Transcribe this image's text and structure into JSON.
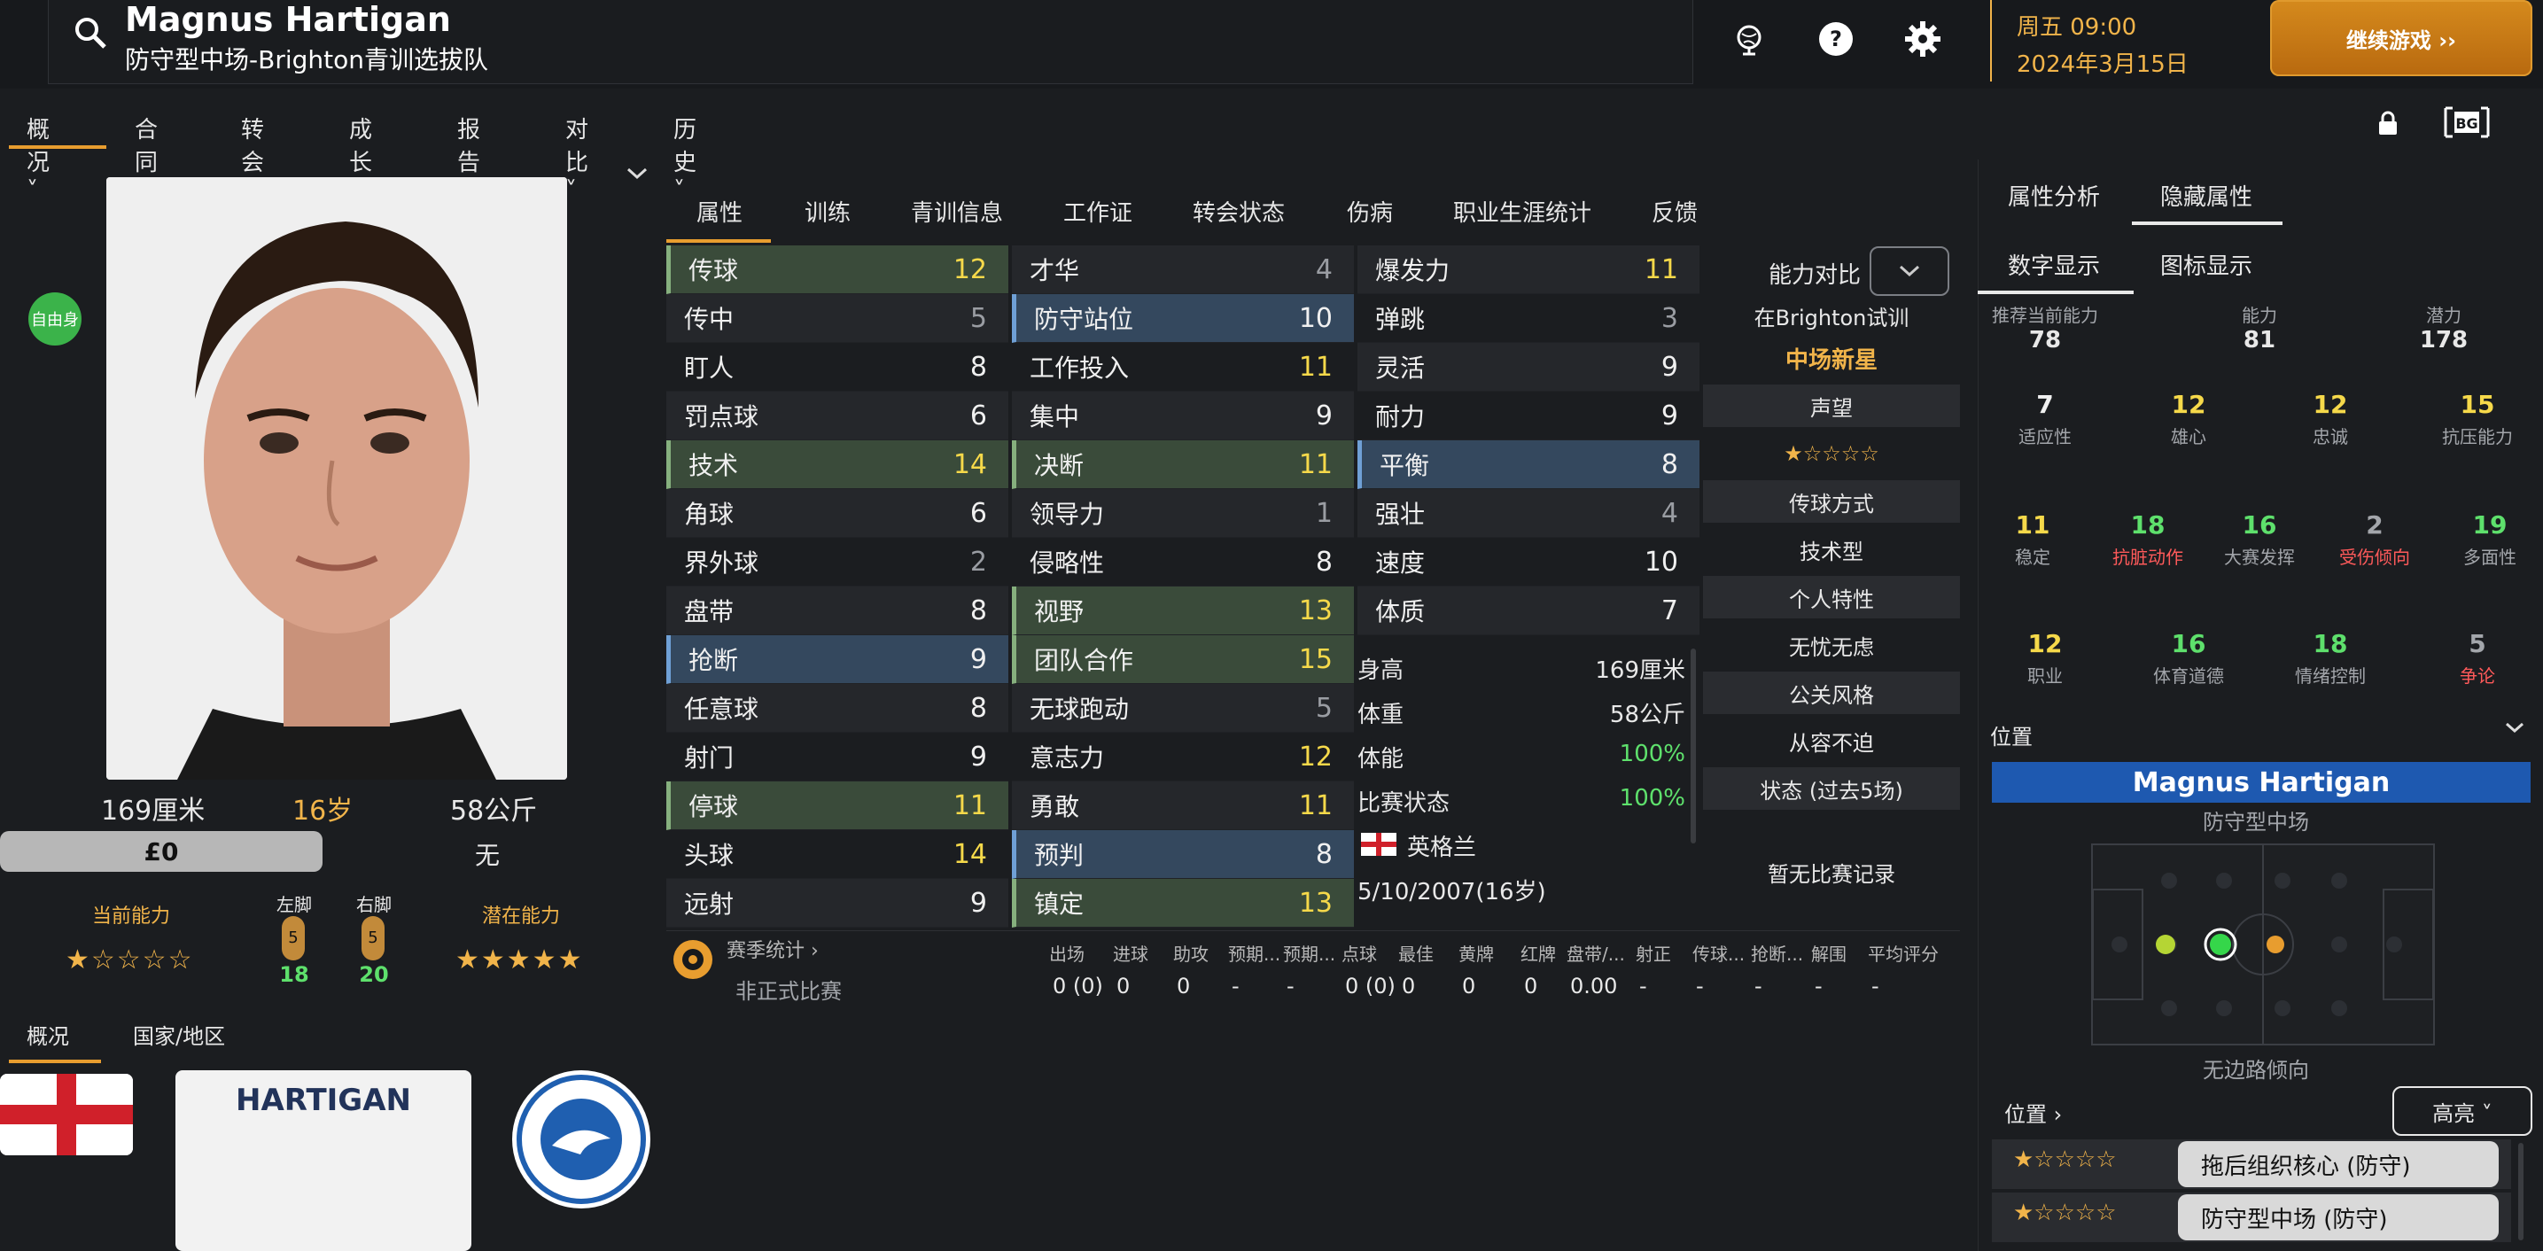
{
  "header": {
    "player_name": "Magnus Hartigan",
    "player_sub": "防守型中场-Brighton青训选拔队",
    "date_line1": "周五 09:00",
    "date_line2": "2024年3月15日",
    "continue_label": "继续游戏 ››"
  },
  "main_nav": [
    "概况 ˅",
    "合同 ˅",
    "转会 ˅",
    "成长 ˅",
    "报告 ˅",
    "对比 ˅",
    "历史 ˅"
  ],
  "left": {
    "free_badge": "自由身",
    "height": "169厘米",
    "age": "16岁",
    "weight": "58公斤",
    "value": "£0",
    "club_status": "无",
    "ca_label": "当前能力",
    "pa_label": "潜在能力",
    "left_foot_label": "左脚",
    "right_foot_label": "右脚",
    "left_foot_value": "18",
    "right_foot_value": "20",
    "foot_badge": "5",
    "ca_stars": "★☆☆☆☆",
    "pa_stars": "★★★★★",
    "tabs": [
      "概况",
      "国家/地区"
    ],
    "shirt_name": "HARTIGAN"
  },
  "attr_tabs": [
    "属性",
    "训练",
    "青训信息",
    "工作证",
    "转会状态",
    "伤病",
    "职业生涯统计",
    "反馈"
  ],
  "attributes": {
    "technical": [
      {
        "name": "传球",
        "value": "12",
        "style": "hl-g",
        "color": "#f6d94a"
      },
      {
        "name": "传中",
        "value": "5",
        "style": "alt",
        "color": "#9a9da3"
      },
      {
        "name": "盯人",
        "value": "8",
        "style": "",
        "color": "#f0f0f0"
      },
      {
        "name": "罚点球",
        "value": "6",
        "style": "alt",
        "color": "#f0f0f0"
      },
      {
        "name": "技术",
        "value": "14",
        "style": "hl-g",
        "color": "#f6d94a"
      },
      {
        "name": "角球",
        "value": "6",
        "style": "alt",
        "color": "#f0f0f0"
      },
      {
        "name": "界外球",
        "value": "2",
        "style": "",
        "color": "#9a9da3"
      },
      {
        "name": "盘带",
        "value": "8",
        "style": "alt",
        "color": "#f0f0f0"
      },
      {
        "name": "抢断",
        "value": "9",
        "style": "hl-b",
        "color": "#f0f0f0"
      },
      {
        "name": "任意球",
        "value": "8",
        "style": "alt",
        "color": "#f0f0f0"
      },
      {
        "name": "射门",
        "value": "9",
        "style": "",
        "color": "#f0f0f0"
      },
      {
        "name": "停球",
        "value": "11",
        "style": "hl-g",
        "color": "#f6d94a"
      },
      {
        "name": "头球",
        "value": "14",
        "style": "",
        "color": "#f6d94a"
      },
      {
        "name": "远射",
        "value": "9",
        "style": "alt",
        "color": "#f0f0f0"
      }
    ],
    "mental": [
      {
        "name": "才华",
        "value": "4",
        "style": "alt",
        "color": "#9a9da3"
      },
      {
        "name": "防守站位",
        "value": "10",
        "style": "hl-b",
        "color": "#f0f0f0"
      },
      {
        "name": "工作投入",
        "value": "11",
        "style": "",
        "color": "#f6d94a"
      },
      {
        "name": "集中",
        "value": "9",
        "style": "alt",
        "color": "#f0f0f0"
      },
      {
        "name": "决断",
        "value": "11",
        "style": "hl-g",
        "color": "#f6d94a"
      },
      {
        "name": "领导力",
        "value": "1",
        "style": "alt",
        "color": "#9a9da3"
      },
      {
        "name": "侵略性",
        "value": "8",
        "style": "",
        "color": "#f0f0f0"
      },
      {
        "name": "视野",
        "value": "13",
        "style": "hl-g",
        "color": "#f6d94a"
      },
      {
        "name": "团队合作",
        "value": "15",
        "style": "hl-g",
        "color": "#f6d94a"
      },
      {
        "name": "无球跑动",
        "value": "5",
        "style": "alt",
        "color": "#9a9da3"
      },
      {
        "name": "意志力",
        "value": "12",
        "style": "",
        "color": "#f6d94a"
      },
      {
        "name": "勇敢",
        "value": "11",
        "style": "alt",
        "color": "#f6d94a"
      },
      {
        "name": "预判",
        "value": "8",
        "style": "hl-b",
        "color": "#f0f0f0"
      },
      {
        "name": "镇定",
        "value": "13",
        "style": "hl-g",
        "color": "#f6d94a"
      }
    ],
    "physical": [
      {
        "name": "爆发力",
        "value": "11",
        "style": "alt",
        "color": "#f6d94a"
      },
      {
        "name": "弹跳",
        "value": "3",
        "style": "",
        "color": "#9a9da3"
      },
      {
        "name": "灵活",
        "value": "9",
        "style": "alt",
        "color": "#f0f0f0"
      },
      {
        "name": "耐力",
        "value": "9",
        "style": "",
        "color": "#f0f0f0"
      },
      {
        "name": "平衡",
        "value": "8",
        "style": "hl-b",
        "color": "#f0f0f0"
      },
      {
        "name": "强壮",
        "value": "4",
        "style": "alt",
        "color": "#9a9da3"
      },
      {
        "name": "速度",
        "value": "10",
        "style": "",
        "color": "#f0f0f0"
      },
      {
        "name": "体质",
        "value": "7",
        "style": "alt",
        "color": "#f0f0f0"
      }
    ]
  },
  "bio": [
    {
      "k": "身高",
      "v": "169厘米",
      "c": "#f0f0f0"
    },
    {
      "k": "体重",
      "v": "58公斤",
      "c": "#f0f0f0"
    },
    {
      "k": "体能",
      "v": "100%",
      "c": "#5ee06c"
    },
    {
      "k": "比赛状态",
      "v": "100%",
      "c": "#5ee06c"
    }
  ],
  "nation": "英格兰",
  "birth": "5/10/2007(16岁)",
  "compare": {
    "title": "能力对比",
    "trial": "在Brighton试训",
    "tag": "中场新星",
    "rep_label": "声望",
    "rep_stars": "★☆☆☆☆",
    "pass_label": "传球方式",
    "pass_value": "技术型",
    "trait_label": "个人特性",
    "trait_value": "无忧无虑",
    "pr_label": "公关风格",
    "pr_value": "从容不迫",
    "form_label": "状态 (过去5场)",
    "form_value": "暂无比赛记录"
  },
  "season": {
    "title": "赛季统计 ›",
    "headers": [
      "出场",
      "进球",
      "助攻",
      "预期...",
      "预期...",
      "点球",
      "最佳",
      "黄牌",
      "红牌",
      "盘带/...",
      "射正",
      "传球...",
      "抢断...",
      "解围",
      "平均评分"
    ],
    "row_label": "非正式比赛",
    "values": [
      "0 (0)",
      "0",
      "0",
      "-",
      "-",
      "0 (0)",
      "0",
      "0",
      "0",
      "0.00",
      "-",
      "-",
      "-",
      "-",
      "-"
    ]
  },
  "right": {
    "tabs": [
      "属性分析",
      "隐藏属性"
    ],
    "subtabs": [
      "数字显示",
      "图标显示"
    ],
    "top_stats": [
      {
        "label": "推荐当前能力",
        "value": "78"
      },
      {
        "label": "能力",
        "value": "81"
      },
      {
        "label": "潜力",
        "value": "178"
      }
    ],
    "hidden": [
      {
        "v": "7",
        "l": "适应性",
        "vc": "#f0f0f0",
        "lc": "#a3a6ab"
      },
      {
        "v": "12",
        "l": "雄心",
        "vc": "#f6d94a",
        "lc": "#a3a6ab"
      },
      {
        "v": "12",
        "l": "忠诚",
        "vc": "#f6d94a",
        "lc": "#a3a6ab"
      },
      {
        "v": "15",
        "l": "抗压能力",
        "vc": "#f6d94a",
        "lc": "#a3a6ab"
      },
      {
        "v": "11",
        "l": "稳定",
        "vc": "#f6d94a",
        "lc": "#a3a6ab"
      },
      {
        "v": "18",
        "l": "抗脏动作",
        "vc": "#5ee06c",
        "lc": "#ff5a5a"
      },
      {
        "v": "16",
        "l": "大赛发挥",
        "vc": "#5ee06c",
        "lc": "#a3a6ab"
      },
      {
        "v": "2",
        "l": "受伤倾向",
        "vc": "#a3a6ab",
        "lc": "#ff5a5a"
      },
      {
        "v": "19",
        "l": "多面性",
        "vc": "#5ee06c",
        "lc": "#a3a6ab"
      },
      {
        "v": "12",
        "l": "职业",
        "vc": "#f6d94a",
        "lc": "#a3a6ab"
      },
      {
        "v": "16",
        "l": "体育道德",
        "vc": "#5ee06c",
        "lc": "#a3a6ab"
      },
      {
        "v": "18",
        "l": "情绪控制",
        "vc": "#5ee06c",
        "lc": "#a3a6ab"
      },
      {
        "v": "5",
        "l": "争论",
        "vc": "#a3a6ab",
        "lc": "#ff5a5a"
      }
    ],
    "position_title": "位置",
    "position_name": "Magnus Hartigan",
    "position_role": "防守型中场",
    "side_tendency": "无边路倾向",
    "pos_label": "位置 ›",
    "highlight": "高亮 ˅",
    "roles": [
      "拖后组织核心 (防守)",
      "防守型中场 (防守)"
    ],
    "role_stars": "★☆☆☆☆"
  }
}
